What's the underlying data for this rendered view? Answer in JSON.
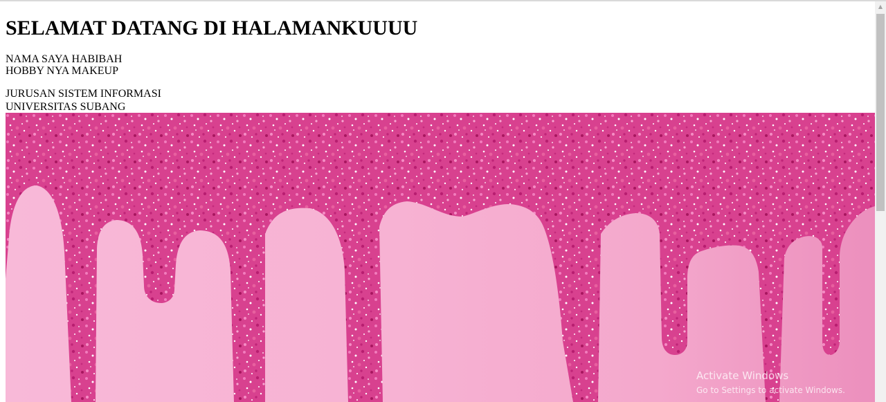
{
  "heading": "SELAMAT DATANG DI HALAMANKUUUU",
  "lines": [
    "NAMA SAYA HABIBAH",
    "HOBBY NYA MAKEUP",
    "JURUSAN SISTEM INFORMASI",
    "UNIVERSITAS SUBANG"
  ],
  "banner": {
    "image": "pink-glitter-drip-image",
    "glitter_colors": [
      "#d4388f",
      "#e55aa6",
      "#b81d70",
      "#f07bbb",
      "#ffffff"
    ],
    "background_colors": [
      "#f8b9d8",
      "#f4a8cc",
      "#ec8fbd"
    ]
  },
  "overlay": {
    "title": "Activate Windows",
    "subtitle": "Go to Settings to activate Windows."
  },
  "scrollbar": {
    "up_arrow_icon": "arrow-up-icon"
  }
}
